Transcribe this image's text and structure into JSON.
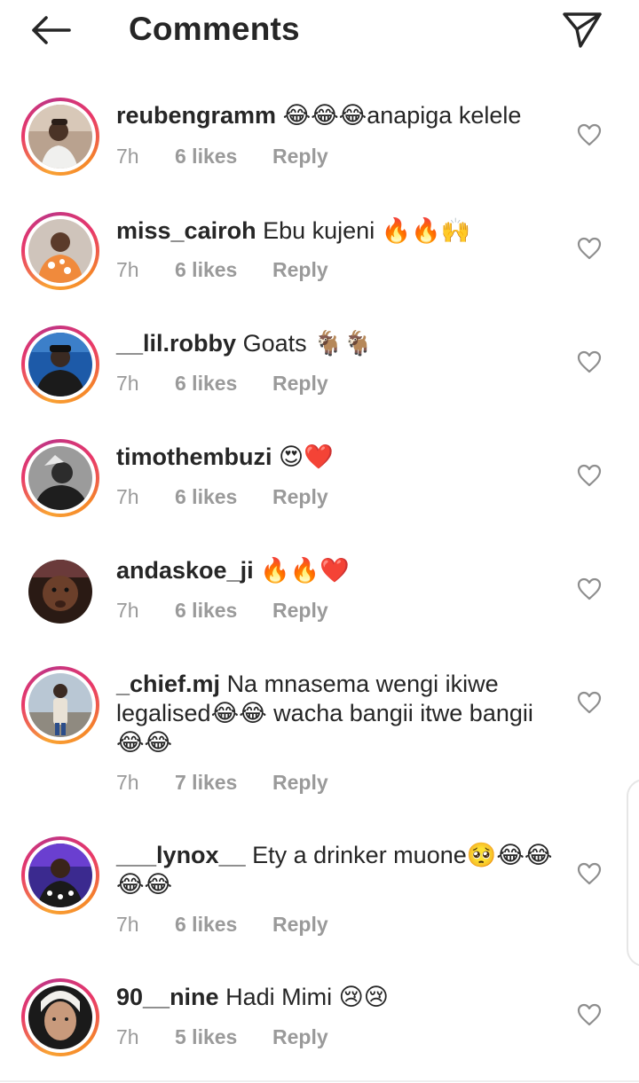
{
  "header": {
    "title": "Comments",
    "back_icon": "arrow-left-icon",
    "send_icon": "paper-plane-icon"
  },
  "colors": {
    "text": "#262626",
    "meta": "#9a9a9a",
    "story_ring": [
      "#f9a234",
      "#e8386a",
      "#c13584"
    ]
  },
  "comments": [
    {
      "username": "reubengramm",
      "text": "😂😂😂anapiga kelele",
      "time": "7h",
      "likes": "6 likes",
      "reply": "Reply"
    },
    {
      "username": "miss_cairoh",
      "text": "Ebu kujeni 🔥🔥🙌",
      "time": "7h",
      "likes": "6 likes",
      "reply": "Reply"
    },
    {
      "username": "__lil.robby",
      "text": "Goats 🐐🐐",
      "time": "7h",
      "likes": "6 likes",
      "reply": "Reply"
    },
    {
      "username": "timothembuzi",
      "text": "😍❤️",
      "time": "7h",
      "likes": "6 likes",
      "reply": "Reply"
    },
    {
      "username": "andaskoe_ji",
      "text": "🔥🔥❤️",
      "time": "7h",
      "likes": "6 likes",
      "reply": "Reply"
    },
    {
      "username": "_chief.mj",
      "text": "Na mnasema wengi ikiwe legalised😂😂 wacha bangii itwe bangii😂😂",
      "time": "7h",
      "likes": "7 likes",
      "reply": "Reply"
    },
    {
      "username": "___lynox__",
      "text": "Ety a drinker muone🥺😂😂😂😂",
      "time": "7h",
      "likes": "6 likes",
      "reply": "Reply"
    },
    {
      "username": "90__nine",
      "text": "Hadi Mimi 😢😢",
      "time": "7h",
      "likes": "5 likes",
      "reply": "Reply"
    }
  ]
}
